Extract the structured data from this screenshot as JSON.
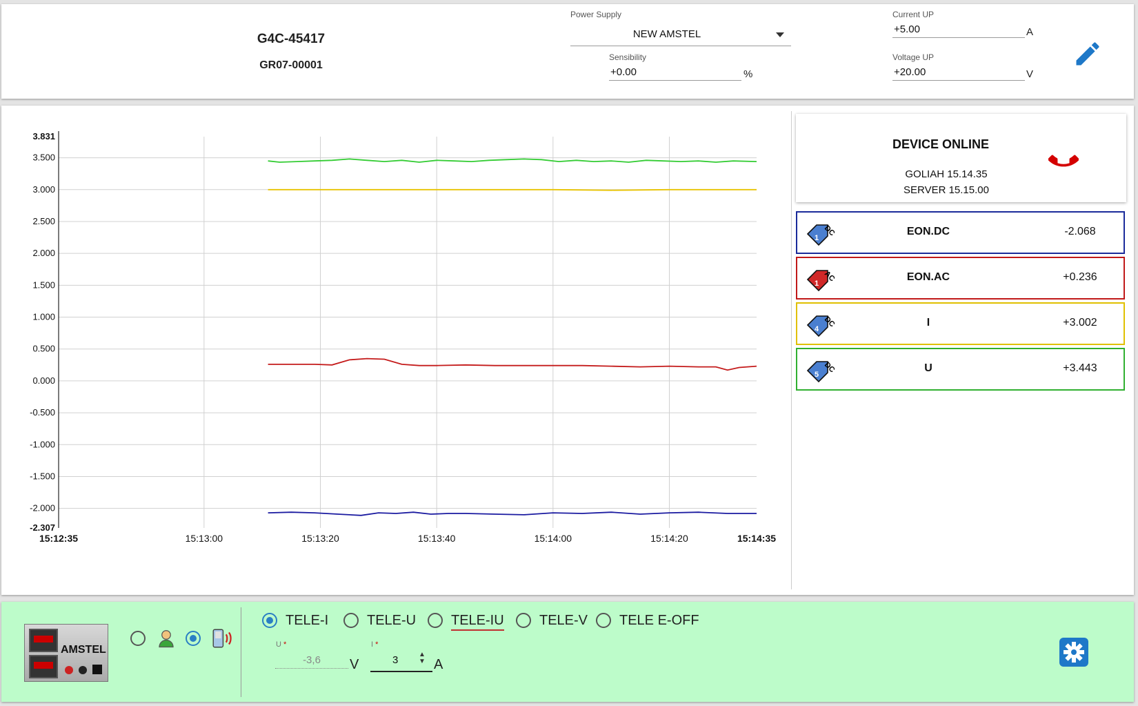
{
  "header": {
    "device_code": "G4C-45417",
    "device_group": "GR07-00001",
    "power_supply": {
      "label": "Power Supply",
      "value": "NEW AMSTEL"
    },
    "sensibility": {
      "label": "Sensibility",
      "value": "+0.00",
      "unit": "%"
    },
    "current_up": {
      "label": "Current UP",
      "value": "+5.00",
      "unit": "A"
    },
    "voltage_up": {
      "label": "Voltage UP",
      "value": "+20.00",
      "unit": "V"
    },
    "edit_icon": "pencil-icon"
  },
  "status": {
    "title": "DEVICE ONLINE",
    "goliah": "GOLIAH 15.14.35",
    "server": "SERVER 15.15.00",
    "icon": "phone-icon",
    "icon_color": "#d40000"
  },
  "channels": [
    {
      "badge": "DC",
      "num": "1",
      "name": "EON.DC",
      "value": "-2.068",
      "color": "#1a2a9a",
      "tag_color": "#4a7fd0"
    },
    {
      "badge": "AC",
      "num": "1",
      "name": "EON.AC",
      "value": "+0.236",
      "color": "#c01818",
      "tag_color": "#d02828"
    },
    {
      "badge": "DC",
      "num": "4",
      "name": "I",
      "value": "+3.002",
      "color": "#e0c000",
      "tag_color": "#4a7fd0"
    },
    {
      "badge": "DC",
      "num": "5",
      "name": "U",
      "value": "+3.443",
      "color": "#30b030",
      "tag_color": "#4a7fd0"
    }
  ],
  "chart_data": {
    "type": "line",
    "ylim": [
      -2.307,
      3.831
    ],
    "yticks": [
      "3.831",
      "3.500",
      "3.000",
      "2.500",
      "2.000",
      "1.500",
      "1.000",
      "0.500",
      "0.000",
      "-0.500",
      "-1.000",
      "-1.500",
      "-2.000",
      "-2.307"
    ],
    "ytick_values": [
      3.831,
      3.5,
      3.0,
      2.5,
      2.0,
      1.5,
      1.0,
      0.5,
      0.0,
      -0.5,
      -1.0,
      -1.5,
      -2.0,
      -2.307
    ],
    "xlim_seconds": [
      0,
      120
    ],
    "xticks": [
      "15:12:35",
      "15:13:00",
      "15:13:20",
      "15:13:40",
      "15:14:00",
      "15:14:20",
      "15:14:35"
    ],
    "xtick_seconds": [
      0,
      25,
      45,
      65,
      85,
      105,
      120
    ],
    "grid": true,
    "series": [
      {
        "color": "#33cc33",
        "x": [
          36,
          38,
          41,
          44,
          47,
          50,
          53,
          56,
          59,
          62,
          65,
          68,
          71,
          74,
          77,
          80,
          83,
          86,
          89,
          92,
          95,
          98,
          101,
          104,
          107,
          110,
          113,
          116,
          120
        ],
        "y": [
          3.45,
          3.43,
          3.44,
          3.45,
          3.46,
          3.48,
          3.46,
          3.44,
          3.46,
          3.43,
          3.46,
          3.45,
          3.44,
          3.46,
          3.47,
          3.48,
          3.47,
          3.44,
          3.46,
          3.44,
          3.45,
          3.43,
          3.46,
          3.45,
          3.44,
          3.45,
          3.43,
          3.45,
          3.44
        ]
      },
      {
        "color": "#e8c300",
        "x": [
          36,
          45,
          55,
          65,
          75,
          85,
          95,
          105,
          115,
          120
        ],
        "y": [
          3.0,
          3.0,
          3.0,
          3.0,
          3.0,
          3.0,
          2.99,
          3.0,
          3.0,
          3.0
        ]
      },
      {
        "color": "#c41a1a",
        "x": [
          36,
          40,
          44,
          47,
          50,
          53,
          56,
          59,
          62,
          65,
          70,
          75,
          80,
          85,
          90,
          95,
          100,
          105,
          110,
          113,
          115,
          117,
          120
        ],
        "y": [
          0.26,
          0.26,
          0.26,
          0.25,
          0.33,
          0.35,
          0.34,
          0.26,
          0.24,
          0.24,
          0.25,
          0.24,
          0.24,
          0.24,
          0.24,
          0.23,
          0.22,
          0.23,
          0.22,
          0.22,
          0.17,
          0.21,
          0.23
        ]
      },
      {
        "color": "#1a1aa0",
        "x": [
          36,
          40,
          44,
          48,
          52,
          55,
          58,
          61,
          64,
          67,
          70,
          75,
          80,
          85,
          90,
          95,
          100,
          105,
          110,
          115,
          120
        ],
        "y": [
          -2.07,
          -2.06,
          -2.07,
          -2.09,
          -2.11,
          -2.07,
          -2.08,
          -2.06,
          -2.09,
          -2.08,
          -2.08,
          -2.09,
          -2.1,
          -2.07,
          -2.08,
          -2.06,
          -2.09,
          -2.07,
          -2.06,
          -2.08,
          -2.08
        ]
      }
    ]
  },
  "footer": {
    "device_image": "amstel-power-supply",
    "device_image_text": "AMSTEL",
    "mode_icons": [
      "user-icon",
      "remote-device-icon"
    ],
    "tele_options": [
      "TELE-I",
      "TELE-U",
      "TELE-IU",
      "TELE-V",
      "TELE E-OFF"
    ],
    "selected_tele": "TELE-I",
    "u_field": {
      "label": "U",
      "value": "-3,6",
      "unit": "V"
    },
    "i_field": {
      "label": "I",
      "value": "3",
      "unit": "A"
    },
    "required_mark": "*",
    "settings_icon": "gear-icon"
  }
}
